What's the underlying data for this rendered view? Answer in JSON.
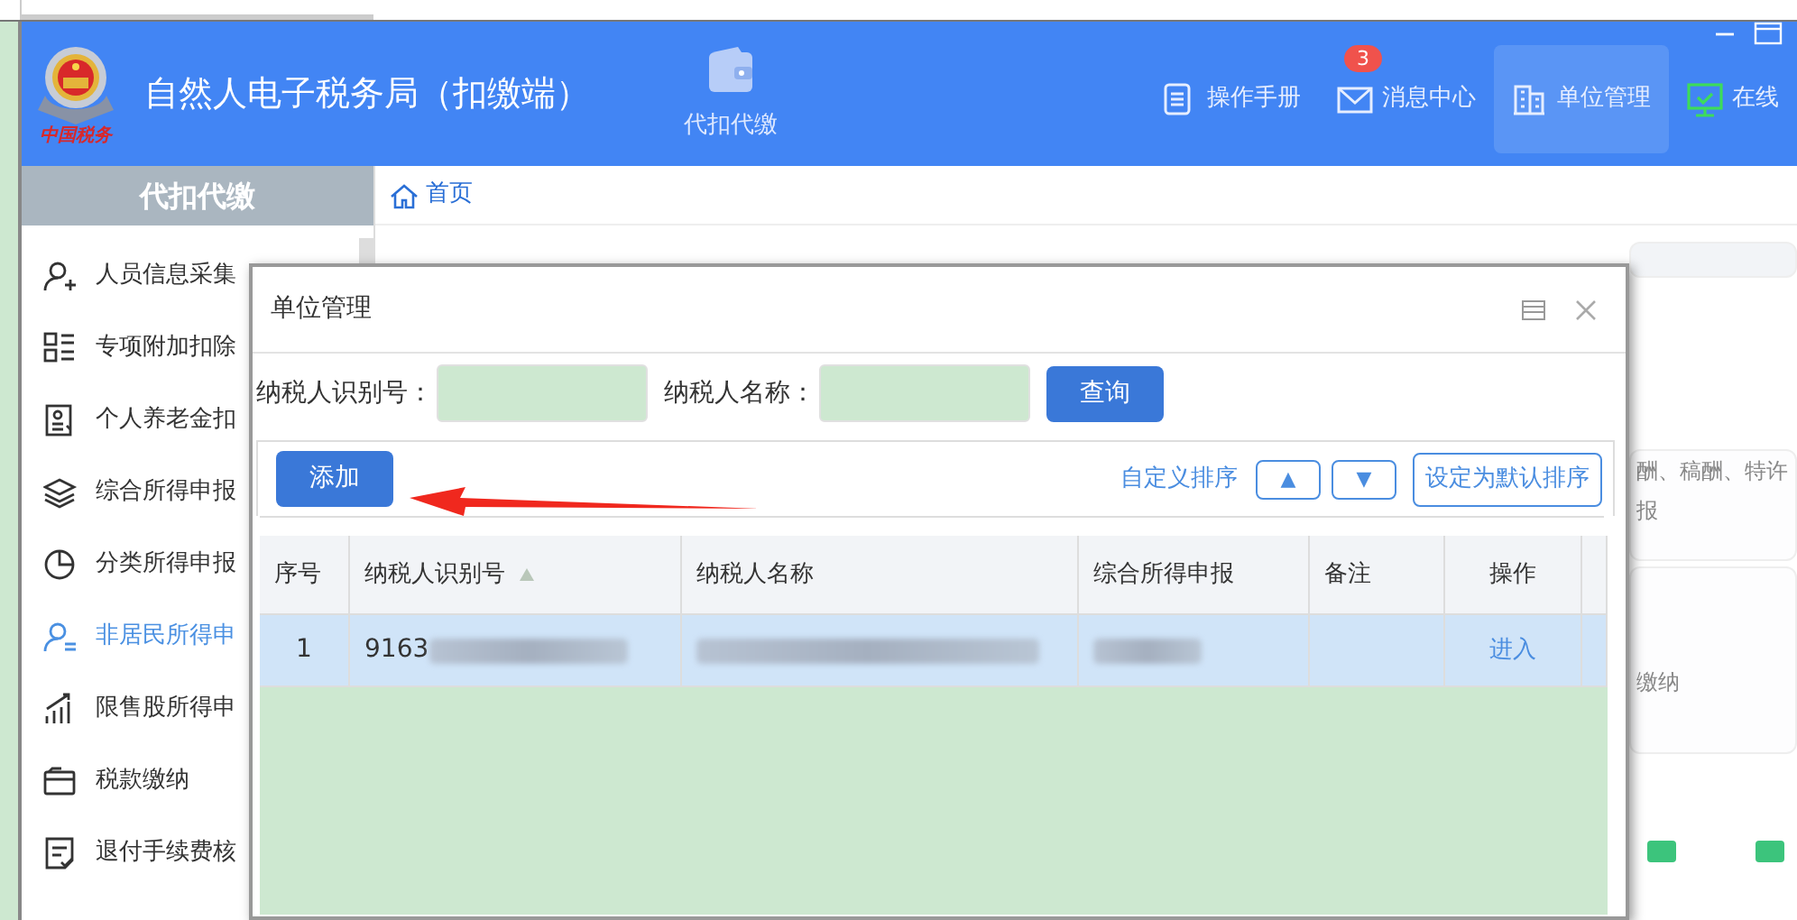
{
  "app": {
    "title": "自然人电子税务局（扣缴端）",
    "logo_text": "中国税务"
  },
  "top_nav": [
    {
      "label": "代扣代缴",
      "kind": "wallet"
    }
  ],
  "toolbar": [
    {
      "label": "操作手册",
      "kind": "manual",
      "selected": false
    },
    {
      "label": "消息中心",
      "kind": "messages",
      "badge": "3",
      "selected": false
    },
    {
      "label": "单位管理",
      "kind": "units",
      "selected": true
    },
    {
      "label": "在线",
      "kind": "online",
      "selected": false
    }
  ],
  "sidebar": {
    "title": "代扣代缴",
    "items": [
      {
        "label": "人员信息采集",
        "kind": "person-add",
        "selected": false
      },
      {
        "label": "专项附加扣除",
        "kind": "list",
        "selected": false
      },
      {
        "label": "个人养老金扣",
        "kind": "pension",
        "selected": false
      },
      {
        "label": "综合所得申报",
        "kind": "layers",
        "selected": false
      },
      {
        "label": "分类所得申报",
        "kind": "pie",
        "selected": false
      },
      {
        "label": "非居民所得申",
        "kind": "person",
        "selected": true
      },
      {
        "label": "限售股所得申",
        "kind": "chart",
        "selected": false
      },
      {
        "label": "税款缴纳",
        "kind": "wallet",
        "selected": false
      },
      {
        "label": "退付手续费核",
        "kind": "check",
        "selected": false
      }
    ]
  },
  "breadcrumb": "首页",
  "background_texts": [
    "酬、稿酬、特许",
    "报",
    "缴纳"
  ],
  "dialog": {
    "title": "单位管理",
    "search_fields": [
      {
        "label": "纳税人识别号："
      },
      {
        "label": "纳税人名称："
      }
    ],
    "search_button": "查询",
    "add_button": "添加",
    "sort_label": "自定义排序",
    "sort_buttons": [
      "▲",
      "▼"
    ],
    "default_sort_button": "设定为默认排序",
    "table": {
      "columns": [
        {
          "label": "序号",
          "sorted": false
        },
        {
          "label": "纳税人识别号",
          "sorted": true
        },
        {
          "label": "纳税人名称",
          "sorted": false
        },
        {
          "label": "综合所得申报",
          "sorted": false
        },
        {
          "label": "备注",
          "sorted": false
        },
        {
          "label": "操作",
          "sorted": false
        }
      ],
      "rows": [
        {
          "selected": true,
          "cells": [
            {
              "text": "1",
              "redacted": false
            },
            {
              "text": "9163",
              "redacted": true
            },
            {
              "text": "",
              "redacted": true
            },
            {
              "text": "",
              "redacted": true
            },
            {
              "text": "",
              "redacted": false
            }
          ],
          "action": "进入"
        }
      ]
    }
  }
}
